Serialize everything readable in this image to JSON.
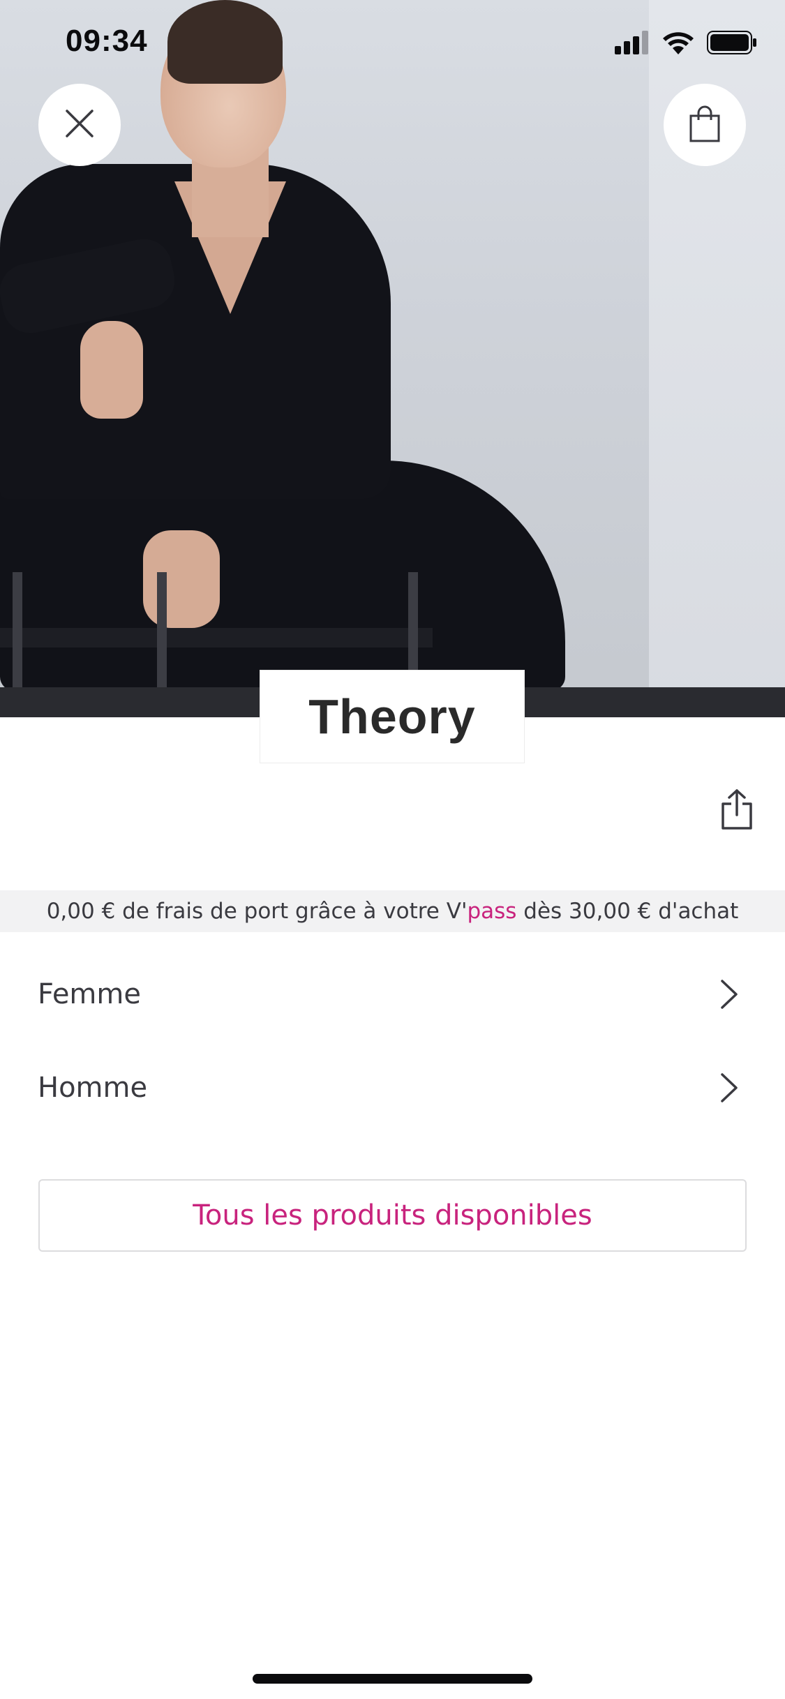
{
  "status_bar": {
    "time": "09:34",
    "icons": [
      "cellular-signal-icon",
      "wifi-icon",
      "battery-icon"
    ]
  },
  "header": {
    "close_icon": "close-icon",
    "bag_icon": "shopping-bag-icon"
  },
  "brand": {
    "name": "Theory"
  },
  "share_icon": "share-icon",
  "shipping_banner": {
    "prefix": "0,00 € de frais de port grâce à votre V'",
    "highlight": "pass",
    "suffix": " dès 30,00 € d'achat"
  },
  "categories": [
    {
      "label": "Femme",
      "icon": "chevron-right-icon"
    },
    {
      "label": "Homme",
      "icon": "chevron-right-icon"
    }
  ],
  "all_products_button": {
    "label": "Tous les produits disponibles"
  },
  "colors": {
    "accent": "#c8237d",
    "text": "#3a3a40",
    "banner_bg": "#f2f2f3"
  }
}
